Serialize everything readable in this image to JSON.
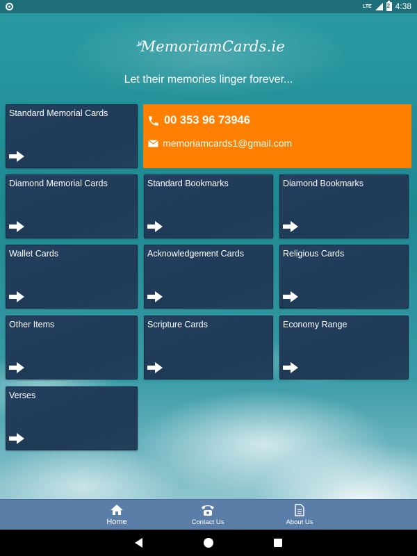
{
  "status_bar": {
    "network": "LTE",
    "battery_level": "2",
    "time": "4:38"
  },
  "header": {
    "logo_text": "MemoriamCards.ie",
    "tagline": "Let their memories linger forever..."
  },
  "contact": {
    "phone": "00 353 96 73946",
    "email": "memoriamcards1@gmail.com",
    "background_color": "#ff7f00"
  },
  "tiles": [
    {
      "label": "Standard Memorial Cards"
    },
    {
      "label": "Diamond Memorial Cards"
    },
    {
      "label": "Standard Bookmarks"
    },
    {
      "label": "Diamond Bookmarks"
    },
    {
      "label": "Wallet Cards"
    },
    {
      "label": "Acknowledgement Cards"
    },
    {
      "label": "Religious Cards"
    },
    {
      "label": "Other Items"
    },
    {
      "label": "Scripture Cards"
    },
    {
      "label": "Economy Range"
    },
    {
      "label": "Verses"
    }
  ],
  "bottom_nav": {
    "items": [
      {
        "label": "Home",
        "icon": "home-icon"
      },
      {
        "label": "Contact Us",
        "icon": "telephone-icon"
      },
      {
        "label": "About Us",
        "icon": "document-icon"
      }
    ],
    "background_color": "#5a7ea8"
  },
  "colors": {
    "tile_background": "#1f3a56",
    "accent": "#ff7f00"
  }
}
